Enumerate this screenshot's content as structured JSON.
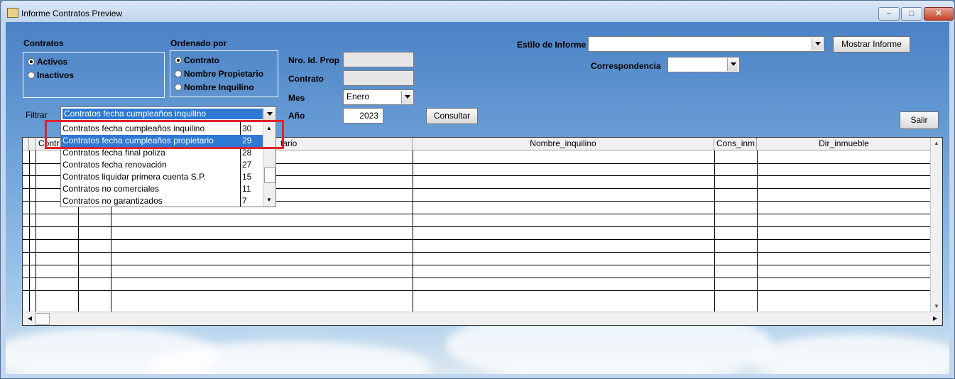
{
  "window": {
    "title": "Informe Contratos Preview",
    "min_glyph": "‒",
    "max_glyph": "□",
    "close_glyph": "✕"
  },
  "contratos": {
    "label": "Contratos",
    "options": [
      {
        "label": "Activos",
        "selected": true
      },
      {
        "label": "Inactivos",
        "selected": false
      }
    ]
  },
  "ordenado": {
    "label": "Ordenado por",
    "options": [
      {
        "label": "Contrato",
        "selected": true
      },
      {
        "label": "Nombre Propietario",
        "selected": false
      },
      {
        "label": "Nombre Inquilino",
        "selected": false
      }
    ]
  },
  "fields": {
    "nro_label": "Nro. Id. Prop",
    "contrato_label": "Contrato",
    "mes_label": "Mes",
    "mes_value": "Enero",
    "anio_label": "Año",
    "anio_value": "2023"
  },
  "filtro": {
    "label": "Filtrar",
    "value": "Contratos fecha cumpleaños inquilino",
    "items": [
      {
        "name": "Contratos fecha cumpleaños inquilino",
        "count": "30",
        "selected": false
      },
      {
        "name": "Contratos fecha cumpleaños propietario",
        "count": "29",
        "selected": true
      },
      {
        "name": "Contratos fecha final poliza",
        "count": "28",
        "selected": false
      },
      {
        "name": "Contratos fecha renovación",
        "count": "27",
        "selected": false
      },
      {
        "name": "Contratos liquidar primera cuenta S.P.",
        "count": "15",
        "selected": false
      },
      {
        "name": "Contratos no comerciales",
        "count": "11",
        "selected": false
      },
      {
        "name": "Contratos no garantizados",
        "count": "7",
        "selected": false
      }
    ]
  },
  "buttons": {
    "consultar": "Consultar",
    "mostrar": "Mostrar Informe",
    "salir": "Salir"
  },
  "estilo": {
    "label": "Estilo de Informe",
    "value": ""
  },
  "correspondencia": {
    "label": "Correspondencia",
    "value": ""
  },
  "grid": {
    "columns": [
      "Contr",
      "tario",
      "Nombre_inquilino",
      "Cons_inm",
      "Dir_inmueble"
    ]
  },
  "colors": {
    "selection": "#2d79d4",
    "highlight": "#e0232e"
  }
}
